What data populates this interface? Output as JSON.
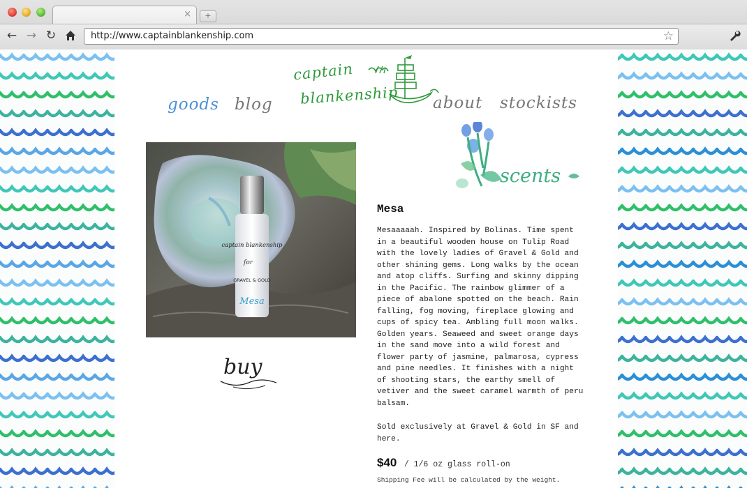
{
  "browser": {
    "url": "http://www.captainblankenship.com",
    "new_tab_symbol": "+",
    "close_symbol": "×"
  },
  "logo": {
    "line1": "captain",
    "line2": "blankenship"
  },
  "nav": {
    "goods": "goods",
    "blog": "blog",
    "about": "about",
    "stockists": "stockists"
  },
  "section_art": {
    "label": "scents"
  },
  "product": {
    "title": "Mesa",
    "description": "Mesaaaaah. Inspired by Bolinas. Time spent in a beautiful wooden house on Tulip Road with the lovely ladies of Gravel & Gold and other shining gems. Long walks by the ocean and atop cliffs. Surfing and skinny dipping in the Pacific. The rainbow glimmer of a piece of abalone spotted on the beach. Rain falling, fog moving, fireplace glowing and cups of spicy tea. Ambling full moon walks. Golden years. Seaweed and sweet orange days in the sand move into a wild forest and flower party of jasmine, palmarosa, cypress and pine needles. It finishes with a night of shooting stars, the earthy smell of vetiver and the sweet caramel warmth of peru balsam.",
    "sold_note": "Sold exclusively at Gravel & Gold in SF and here.",
    "price": "$40",
    "size": "/ 1/6 oz glass roll-on",
    "shipping_note": "Shipping Fee will be calculated by the weight.",
    "buy_label": "buy",
    "bottle_label": {
      "brand": "captain blankenship",
      "for": "for",
      "collab": "GRAVEL & GOLD",
      "scent": "Mesa"
    }
  },
  "colors": {
    "nav_active": "#4c8fd8",
    "logo_green": "#2e9a3b",
    "wave_blue": "#3d6fd0",
    "wave_green": "#2fbf6a",
    "wave_teal": "#3fc7b8"
  }
}
